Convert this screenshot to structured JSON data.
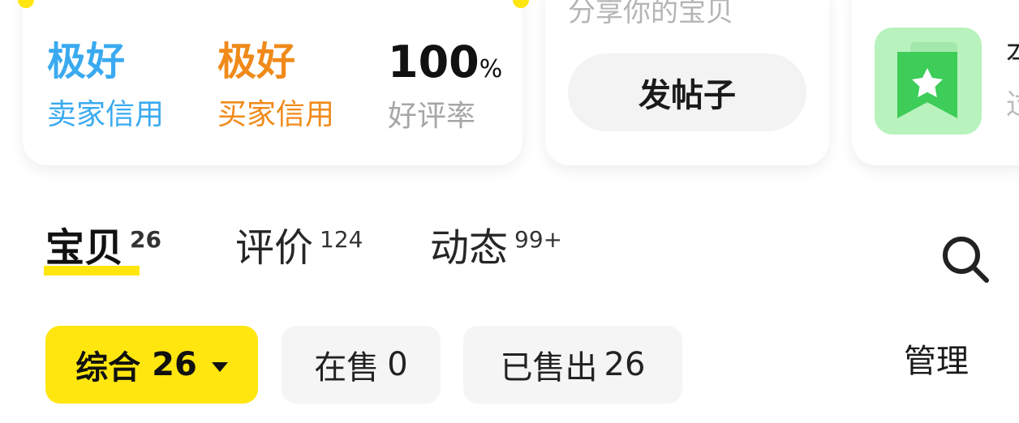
{
  "credit_card": {
    "seller_credit": {
      "value": "极好",
      "label": "卖家信用",
      "color": "#3aaaf0"
    },
    "buyer_credit": {
      "value": "极好",
      "label": "买家信用",
      "color": "#f08a1a"
    },
    "positive_rate": {
      "value": "100",
      "unit": "%",
      "label": "好评率"
    }
  },
  "post_card": {
    "subtitle": "分享你的宝贝",
    "button_label": "发帖子"
  },
  "fav_card": {
    "peek_title": "本",
    "peek_subtitle": "过",
    "icon": "star-bookmark-icon",
    "icon_bg": "#b8f2bd",
    "icon_color": "#3dcd58"
  },
  "tabs": [
    {
      "label": "宝贝",
      "count": "26",
      "active": true
    },
    {
      "label": "评价",
      "count": "124",
      "active": false
    },
    {
      "label": "动态",
      "count": "99+",
      "active": false
    }
  ],
  "filters": {
    "all": {
      "label": "综合",
      "count": "26"
    },
    "on_sale": {
      "label": "在售",
      "count": "0"
    },
    "sold": {
      "label": "已售出",
      "count": "26"
    }
  },
  "manage_label": "管理",
  "accent_color": "#ffe60f"
}
